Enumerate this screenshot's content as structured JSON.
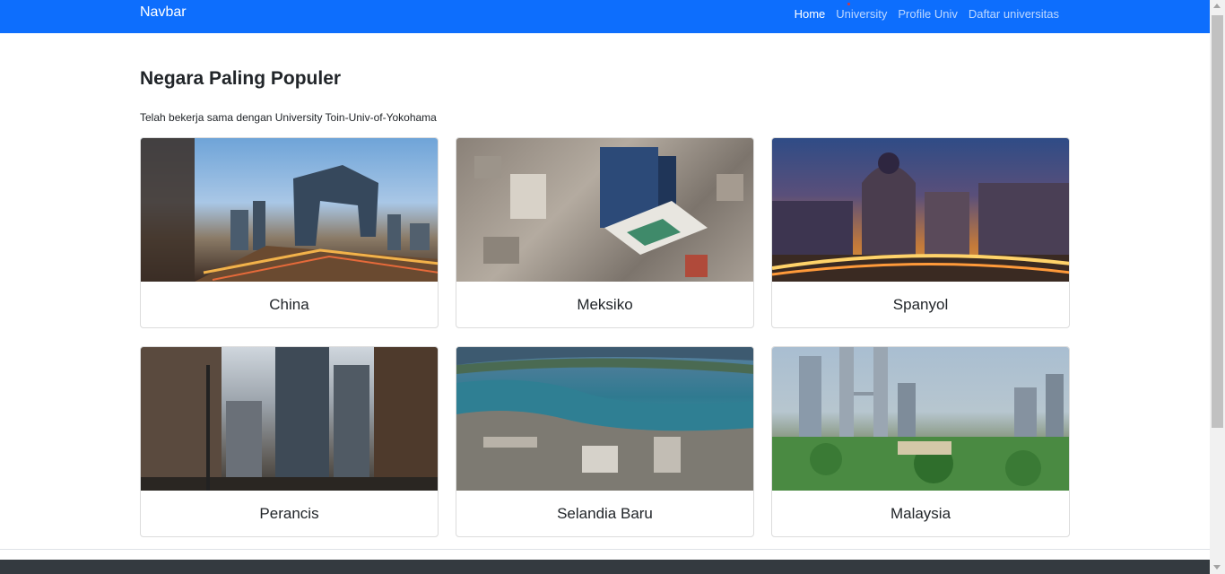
{
  "navbar": {
    "brand": "Navbar",
    "links": [
      {
        "label": "Home",
        "active": true
      },
      {
        "label": "University",
        "active": false
      },
      {
        "label": "Profile Univ",
        "active": false
      },
      {
        "label": "Daftar universitas",
        "active": false
      }
    ],
    "background_color": "#0d6efd"
  },
  "main": {
    "heading": "Negara Paling Populer",
    "subtext": "Telah bekerja sama dengan University Toin-Univ-of-Yokohama",
    "cards": [
      {
        "title": "China",
        "image": "city-skyline-beijing"
      },
      {
        "title": "Meksiko",
        "image": "aerial-city-mexico"
      },
      {
        "title": "Spanyol",
        "image": "madrid-street-night"
      },
      {
        "title": "Perancis",
        "image": "city-street-buildings"
      },
      {
        "title": "Selandia Baru",
        "image": "wellington-harbour"
      },
      {
        "title": "Malaysia",
        "image": "kuala-lumpur-towers"
      }
    ]
  },
  "footer": {
    "background_color": "#343a40"
  }
}
